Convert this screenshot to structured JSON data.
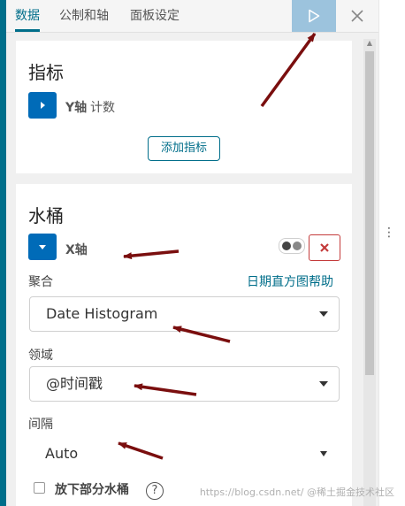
{
  "tabs": [
    {
      "label": "数据",
      "active": true
    },
    {
      "label": "公制和轴",
      "active": false
    },
    {
      "label": "面板设定",
      "active": false
    }
  ],
  "icons": {
    "apply": "play-icon",
    "close": "close-icon",
    "expand": "chevron-right-icon",
    "expanded": "chevron-down-icon",
    "remove": "x-icon",
    "help": "question-icon",
    "caret": "caret-down-icon",
    "kebab": "kebab-icon"
  },
  "colors": {
    "accent": "#006e8a",
    "toggle_blue": "#006bb8",
    "apply_bg": "#9cc3dd",
    "remove_red": "#c43b3b",
    "annotation_arrow": "#7a0e0e"
  },
  "metrics": {
    "title": "指标",
    "item": {
      "bold": "Y轴",
      "text": "计数"
    },
    "add_button": "添加指标"
  },
  "buckets": {
    "title": "水桶",
    "item": {
      "bold": "X轴"
    },
    "aggregation": {
      "label": "聚合",
      "help_link": "日期直方图帮助",
      "value": "Date Histogram"
    },
    "field": {
      "label": "领域",
      "value": "@时间戳"
    },
    "interval": {
      "label": "间隔",
      "value": "Auto"
    },
    "drop_partial": {
      "label": "放下部分水桶",
      "help_mark": "?",
      "checked": false
    }
  },
  "watermark": "https://blog.csdn.net/ @稀土掘金技术社区"
}
